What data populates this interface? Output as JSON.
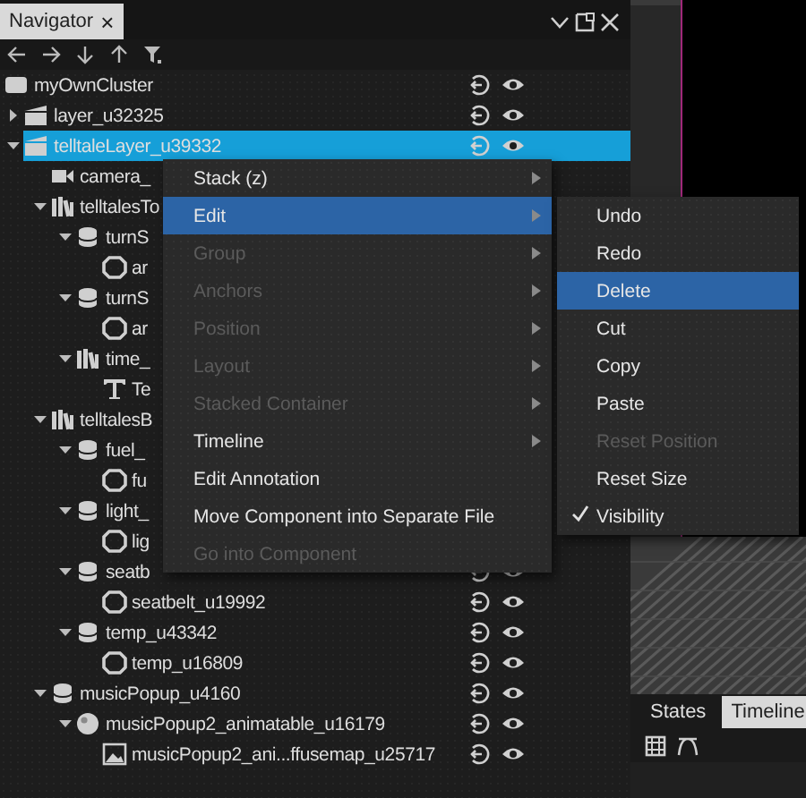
{
  "navigator": {
    "tab_title": "Navigator",
    "tab_close": "×",
    "tree": [
      {
        "label": "myOwnCluster",
        "kind": "cluster",
        "selected": false,
        "row_icons": true,
        "children": [
          {
            "label": "layer_u32325",
            "kind": "layer",
            "selected": false,
            "row_icons": true,
            "expanded": false
          },
          {
            "label": "telltaleLayer_u39332",
            "kind": "layer",
            "selected": true,
            "row_icons": true,
            "expanded": true,
            "children": [
              {
                "label": "camera_",
                "kind": "camera",
                "selected": false
              },
              {
                "label": "telltalesTo",
                "kind": "group",
                "selected": false,
                "expanded": true,
                "children": [
                  {
                    "label": "turnS",
                    "kind": "stack",
                    "selected": false,
                    "expanded": true,
                    "children": [
                      {
                        "label": "ar",
                        "kind": "node",
                        "selected": false
                      }
                    ]
                  },
                  {
                    "label": "turnS",
                    "kind": "stack",
                    "selected": false,
                    "expanded": true,
                    "children": [
                      {
                        "label": "ar",
                        "kind": "node",
                        "selected": false
                      }
                    ]
                  },
                  {
                    "label": "time_",
                    "kind": "group",
                    "selected": false,
                    "expanded": true,
                    "children": [
                      {
                        "label": "Te",
                        "kind": "text",
                        "selected": false
                      }
                    ]
                  }
                ]
              },
              {
                "label": "telltalesB",
                "kind": "group",
                "selected": false,
                "expanded": true,
                "children": [
                  {
                    "label": "fuel_",
                    "kind": "stack",
                    "selected": false,
                    "expanded": true,
                    "children": [
                      {
                        "label": "fu",
                        "kind": "node",
                        "selected": false
                      }
                    ]
                  },
                  {
                    "label": "light_",
                    "kind": "stack",
                    "selected": false,
                    "expanded": true,
                    "children": [
                      {
                        "label": "lig",
                        "kind": "node",
                        "selected": false
                      }
                    ]
                  },
                  {
                    "label": "seatb",
                    "kind": "stack",
                    "selected": false,
                    "row_icons": true,
                    "expanded": true,
                    "children": [
                      {
                        "label": "seatbelt_u19992",
                        "kind": "node",
                        "selected": false,
                        "row_icons": true
                      }
                    ]
                  },
                  {
                    "label": "temp_u43342",
                    "kind": "stack",
                    "selected": false,
                    "row_icons": true,
                    "expanded": true,
                    "children": [
                      {
                        "label": "temp_u16809",
                        "kind": "node",
                        "selected": false,
                        "row_icons": true
                      }
                    ]
                  }
                ]
              },
              {
                "label": "musicPopup_u4160",
                "kind": "stack",
                "selected": false,
                "row_icons": true,
                "expanded": true,
                "children": [
                  {
                    "label": "musicPopup2_animatable_u16179",
                    "kind": "sphere",
                    "selected": false,
                    "row_icons": true,
                    "expanded": true,
                    "children": [
                      {
                        "label": "musicPopup2_ani...ffusemap_u25717",
                        "kind": "image",
                        "selected": false,
                        "row_icons": true
                      }
                    ]
                  }
                ]
              }
            ]
          }
        ]
      }
    ]
  },
  "context_menu": [
    {
      "label": "Stack (z)",
      "disabled": false,
      "submenu": true,
      "selected": false
    },
    {
      "label": "Edit",
      "disabled": false,
      "submenu": true,
      "selected": true
    },
    {
      "label": "Group",
      "disabled": true,
      "submenu": true,
      "selected": false
    },
    {
      "label": "Anchors",
      "disabled": true,
      "submenu": true,
      "selected": false
    },
    {
      "label": "Position",
      "disabled": true,
      "submenu": true,
      "selected": false
    },
    {
      "label": "Layout",
      "disabled": true,
      "submenu": true,
      "selected": false
    },
    {
      "label": "Stacked Container",
      "disabled": true,
      "submenu": true,
      "selected": false
    },
    {
      "label": "Timeline",
      "disabled": false,
      "submenu": true,
      "selected": false
    },
    {
      "label": "Edit Annotation",
      "disabled": false,
      "submenu": false,
      "selected": false
    },
    {
      "label": "Move Component into Separate File",
      "disabled": false,
      "submenu": false,
      "selected": false
    },
    {
      "label": "Go into Component",
      "disabled": true,
      "submenu": false,
      "selected": false
    }
  ],
  "edit_submenu": [
    {
      "label": "Undo",
      "disabled": false,
      "selected": false,
      "checked": false
    },
    {
      "label": "Redo",
      "disabled": false,
      "selected": false,
      "checked": false
    },
    {
      "label": "Delete",
      "disabled": false,
      "selected": true,
      "checked": false
    },
    {
      "label": "Cut",
      "disabled": false,
      "selected": false,
      "checked": false
    },
    {
      "label": "Copy",
      "disabled": false,
      "selected": false,
      "checked": false
    },
    {
      "label": "Paste",
      "disabled": false,
      "selected": false,
      "checked": false
    },
    {
      "label": "Reset Position",
      "disabled": true,
      "selected": false,
      "checked": false
    },
    {
      "label": "Reset Size",
      "disabled": false,
      "selected": false,
      "checked": false
    },
    {
      "label": "Visibility",
      "disabled": false,
      "selected": false,
      "checked": true
    }
  ],
  "bottom_tabs": [
    {
      "label": "States",
      "selected": false
    },
    {
      "label": "Timeline",
      "selected": true
    }
  ]
}
